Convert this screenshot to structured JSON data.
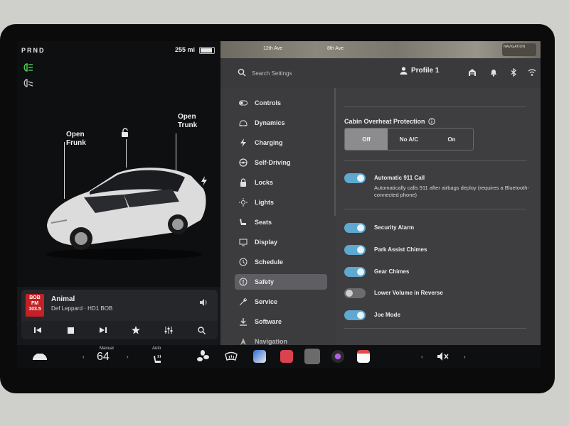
{
  "status": {
    "gear": "PRND",
    "range": "255 mi"
  },
  "car": {
    "frunk_label_1": "Open",
    "frunk_label_2": "Frunk",
    "trunk_label_1": "Open",
    "trunk_label_2": "Trunk"
  },
  "media": {
    "station_logo": "BOB FM 103.5",
    "song": "Animal",
    "artist": "Def Leppard · HD1 BOB",
    "controls": [
      "prev-icon",
      "stop-icon",
      "next-icon",
      "star-icon",
      "equalizer-icon",
      "search-icon"
    ]
  },
  "map": {
    "label_1": "12th Ave",
    "label_2": "8th Ave",
    "badge": "NAVIGATION"
  },
  "settings_header": {
    "search_placeholder": "Search Settings",
    "profile": "Profile 1"
  },
  "sidebar": {
    "items": [
      {
        "label": "Controls",
        "icon": "toggle-icon"
      },
      {
        "label": "Dynamics",
        "icon": "car-icon"
      },
      {
        "label": "Charging",
        "icon": "bolt-icon"
      },
      {
        "label": "Self-Driving",
        "icon": "steering-wheel-icon"
      },
      {
        "label": "Locks",
        "icon": "lock-icon"
      },
      {
        "label": "Lights",
        "icon": "sun-icon"
      },
      {
        "label": "Seats",
        "icon": "seat-icon"
      },
      {
        "label": "Display",
        "icon": "display-icon"
      },
      {
        "label": "Schedule",
        "icon": "clock-icon"
      },
      {
        "label": "Safety",
        "icon": "alert-icon",
        "active": true
      },
      {
        "label": "Service",
        "icon": "wrench-icon"
      },
      {
        "label": "Software",
        "icon": "download-icon"
      },
      {
        "label": "Navigation",
        "icon": "navigation-icon"
      }
    ]
  },
  "safety": {
    "cabin_overheat": {
      "title": "Cabin Overheat Protection",
      "options": [
        "Off",
        "No A/C",
        "On"
      ],
      "selected": "Off"
    },
    "auto911": {
      "label": "Automatic 911 Call",
      "description": "Automatically calls 911 after airbags deploy (requires a Bluetooth-connected phone)",
      "enabled": true
    },
    "toggles": [
      {
        "label": "Security Alarm",
        "enabled": true
      },
      {
        "label": "Park Assist Chimes",
        "enabled": true
      },
      {
        "label": "Gear Chimes",
        "enabled": true
      },
      {
        "label": "Lower Volume in Reverse",
        "enabled": false
      },
      {
        "label": "Joe Mode",
        "enabled": true
      }
    ]
  },
  "dock": {
    "climate_mode": "Manual",
    "temperature": "64",
    "seat_heat_mode": "Auto",
    "colors": {
      "accent_toggle": "#5fa8cf",
      "music_app": "#d9434f",
      "calendar_app": "#e24b4b"
    }
  }
}
